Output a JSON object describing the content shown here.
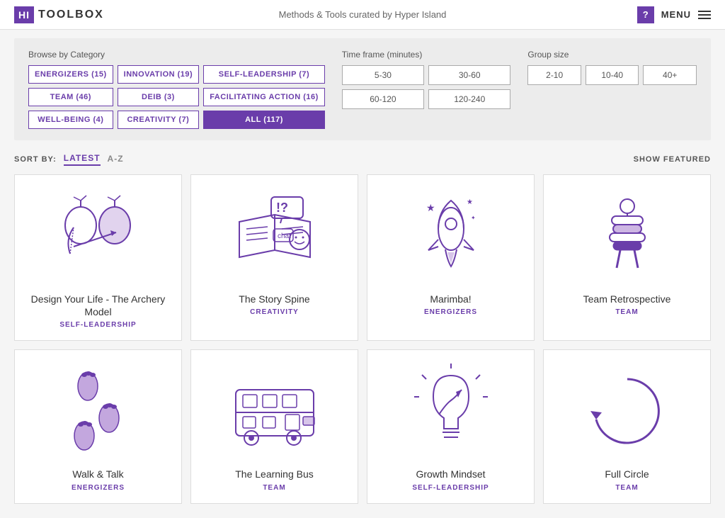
{
  "header": {
    "logo_hi": "HI",
    "logo_text": "TOOLBOX",
    "subtitle": "Methods & Tools curated by Hyper Island",
    "help_label": "?",
    "menu_label": "MENU"
  },
  "filter": {
    "browse_label": "Browse by Category",
    "categories": [
      {
        "id": "energizers",
        "label": "ENERGIZERS (15)",
        "active": false
      },
      {
        "id": "innovation",
        "label": "INNOVATION (19)",
        "active": false
      },
      {
        "id": "self-leadership",
        "label": "SELF-LEADERSHIP (7)",
        "active": false
      },
      {
        "id": "team",
        "label": "TEAM (46)",
        "active": false
      },
      {
        "id": "deib",
        "label": "DEIB (3)",
        "active": false
      },
      {
        "id": "facilitating-action",
        "label": "FACILITATING ACTION (16)",
        "active": false
      },
      {
        "id": "well-being",
        "label": "WELL-BEING (4)",
        "active": false
      },
      {
        "id": "creativity",
        "label": "CREATIVITY (7)",
        "active": false
      },
      {
        "id": "all",
        "label": "ALL (117)",
        "active": true
      }
    ],
    "timeframe_label": "Time frame (minutes)",
    "timeframes": [
      "5-30",
      "30-60",
      "60-120",
      "120-240"
    ],
    "groupsize_label": "Group size",
    "groupsizes": [
      "2-10",
      "10-40",
      "40+"
    ]
  },
  "sortbar": {
    "sort_label": "SORT BY:",
    "sort_options": [
      {
        "label": "LATEST",
        "active": true
      },
      {
        "label": "A-Z",
        "active": false
      }
    ],
    "show_featured": "SHOW FEATURED"
  },
  "cards": [
    {
      "title": "Design Your Life - The Archery Model",
      "category": "SELF-LEADERSHIP",
      "icon": "archery"
    },
    {
      "title": "The Story Spine",
      "category": "CREATIVITY",
      "icon": "book"
    },
    {
      "title": "Marimba!",
      "category": "ENERGIZERS",
      "icon": "rocket"
    },
    {
      "title": "Team Retrospective",
      "category": "TEAM",
      "icon": "hands"
    },
    {
      "title": "Walk & Talk",
      "category": "ENERGIZERS",
      "icon": "footprints"
    },
    {
      "title": "The Learning Bus",
      "category": "TEAM",
      "icon": "bus"
    },
    {
      "title": "Growth Mindset",
      "category": "SELF-LEADERSHIP",
      "icon": "lightbulb"
    },
    {
      "title": "Full Circle",
      "category": "TEAM",
      "icon": "circle"
    }
  ]
}
